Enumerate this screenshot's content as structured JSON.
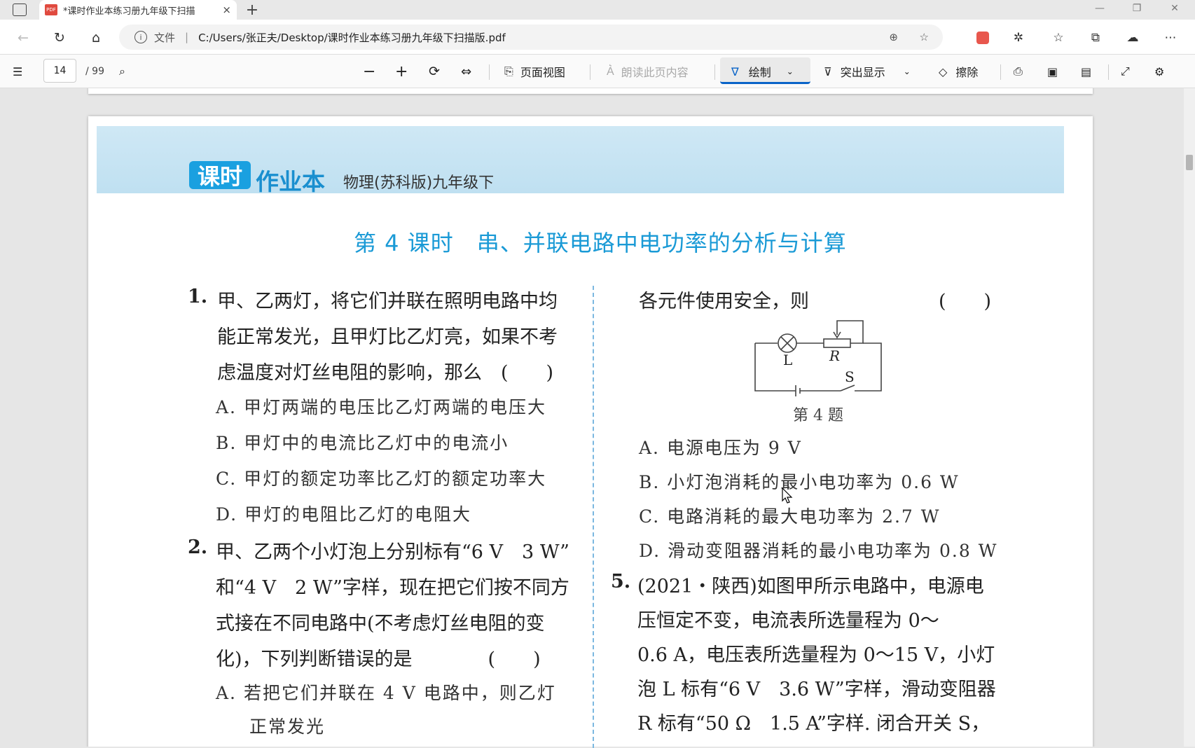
{
  "browser": {
    "tab_title": "*课时作业本练习册九年级下扫描",
    "tab_close": "×",
    "new_tab": "+",
    "file_label": "文件",
    "url": "C:/Users/张正夫/Desktop/课时作业本练习册九年级下扫描版.pdf"
  },
  "pdf_toolbar": {
    "page_current": "14",
    "page_total": "/ 99",
    "page_view_label": "页面视图",
    "read_aloud_label": "朗读此页内容",
    "draw_label": "绘制",
    "highlight_label": "突出显示",
    "erase_label": "擦除"
  },
  "document": {
    "brand_logo_a": "课时",
    "brand_logo_b": "作业本",
    "subject": "物理(苏科版)九年级下",
    "lesson_title": "第 4 课时　串、并联电路中电功率的分析与计算",
    "q1": {
      "num": "1.",
      "lines": [
        "甲、乙两灯，将它们并联在照明电路中均",
        "能正常发光，且甲灯比乙灯亮，如果不考",
        "虑温度对灯丝电阻的影响，那么　(　　)"
      ],
      "options": [
        "A.  甲灯两端的电压比乙灯两端的电压大",
        "B.  甲灯中的电流比乙灯中的电流小",
        "C.  甲灯的额定功率比乙灯的额定功率大",
        "D.  甲灯的电阻比乙灯的电阻大"
      ]
    },
    "q2": {
      "num": "2.",
      "lines": [
        "甲、乙两个小灯泡上分别标有“6 V　3 W”",
        "和“4 V　2 W”字样，现在把它们按不同方",
        "式接在不同电路中(不考虑灯丝电阻的变",
        "化)，下列判断错误的是　　　　(　　)"
      ],
      "options": [
        "A.  若把它们并联在 4 V 电路中，则乙灯",
        "正常发光"
      ]
    },
    "q4": {
      "tail": "各元件使用安全，则",
      "bracket": "(　　)",
      "figure_caption": "第 4 题",
      "label_L": "L",
      "label_R": "R",
      "label_S": "S",
      "options": [
        "A.  电源电压为 9 V",
        "B.  小灯泡消耗的最小电功率为 0.6 W",
        "C.  电路消耗的最大电功率为 2.7 W",
        "D.  滑动变阻器消耗的最小电功率为 0.8 W"
      ]
    },
    "q5": {
      "num": "5.",
      "lines": [
        "(2021・陕西)如图甲所示电路中，电源电",
        "压恒定不变，电流表所选量程为 0～",
        "0.6 A，电压表所选量程为 0～15 V，小灯",
        "泡 L 标有“6 V　3.6 W”字样，滑动变阻器",
        "R 标有“50 Ω　1.5 A”字样. 闭合开关 S，"
      ]
    }
  }
}
